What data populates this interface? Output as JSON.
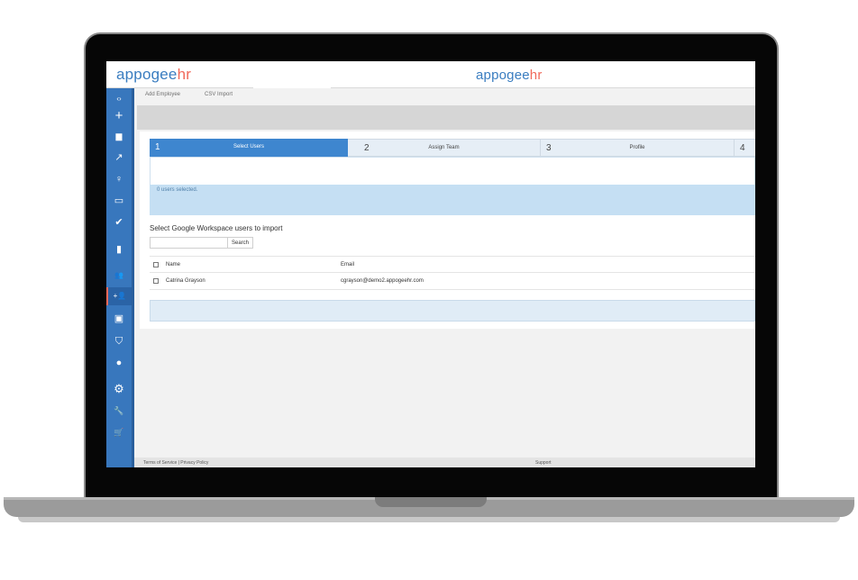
{
  "brand": {
    "name_part1": "appogee",
    "name_part2": "hr",
    "colors": {
      "primary": "#3a7dc0",
      "accent": "#f06a5b",
      "sidebar": "#3877bd"
    }
  },
  "sidebar": {
    "toggle": "‹›",
    "items": [
      {
        "icon": "plus-icon",
        "glyph": "+"
      },
      {
        "icon": "briefcase-icon",
        "glyph": "▆"
      },
      {
        "icon": "trending-icon",
        "glyph": "↗"
      },
      {
        "icon": "lightbulb-icon",
        "glyph": "♀"
      },
      {
        "icon": "devices-icon",
        "glyph": "▭"
      },
      {
        "icon": "check-circle-icon",
        "glyph": "✔"
      },
      {
        "icon": "bar-chart-icon",
        "glyph": "▮"
      },
      {
        "icon": "people-icon",
        "glyph": "👥"
      },
      {
        "icon": "person-add-icon",
        "glyph": "+👤"
      },
      {
        "icon": "contact-card-icon",
        "glyph": "▣"
      },
      {
        "icon": "shield-icon",
        "glyph": "⛉"
      },
      {
        "icon": "account-circle-icon",
        "glyph": "●"
      },
      {
        "icon": "gear-icon",
        "glyph": "⚙"
      },
      {
        "icon": "wrench-icon",
        "glyph": "🔧"
      },
      {
        "icon": "cart-icon",
        "glyph": "🛒"
      }
    ]
  },
  "subnav": {
    "add_employee": "Add Employee",
    "csv_import": "CSV Import"
  },
  "stepper": [
    {
      "num": "1",
      "label": "Select Users",
      "active": true
    },
    {
      "num": "2",
      "label": "Assign Team"
    },
    {
      "num": "3",
      "label": "Profile"
    },
    {
      "num": "4",
      "label": ""
    }
  ],
  "selection": {
    "count_text": "0 users selected."
  },
  "import": {
    "title": "Select Google Workspace users to import",
    "search_placeholder": "",
    "search_button": "Search"
  },
  "table": {
    "headers": {
      "name": "Name",
      "email": "Email"
    },
    "rows": [
      {
        "name": "Catrina Grayson",
        "email": "cgrayson@demo2.appogeehr.com"
      }
    ]
  },
  "footer": {
    "legal": "Terms of Service | Privacy Policy",
    "support": "Support"
  }
}
